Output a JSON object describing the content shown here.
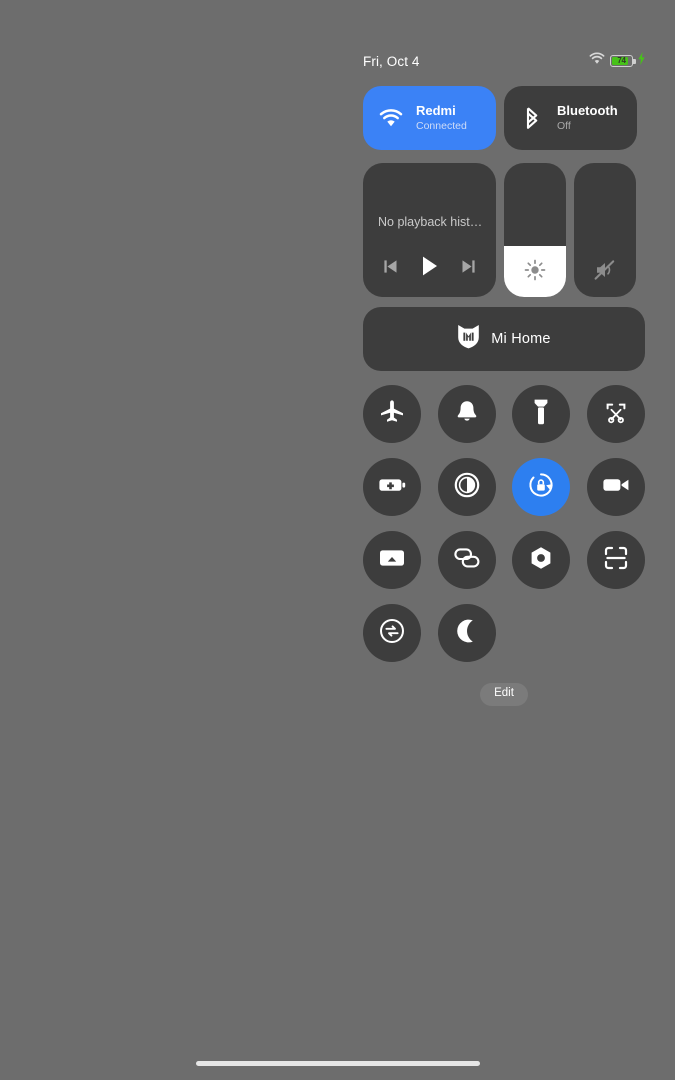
{
  "status_bar": {
    "date": "Fri, Oct 4",
    "wifi_icon": "wifi-icon",
    "battery_level": "74",
    "battery_charging_icon": "charging-bolt-icon"
  },
  "connectivity": [
    {
      "name": "wifi-tile",
      "icon": "wifi-icon",
      "title": "Redmi",
      "subtitle": "Connected",
      "active": true
    },
    {
      "name": "bluetooth-tile",
      "icon": "bluetooth-icon",
      "title": "Bluetooth",
      "subtitle": "Off",
      "active": false
    }
  ],
  "media": {
    "title": "No playback hist…",
    "previous_icon": "skip-previous-icon",
    "play_icon": "play-icon",
    "next_icon": "skip-next-icon"
  },
  "sliders": [
    {
      "name": "brightness-slider",
      "icon": "brightness-sun-icon",
      "value_percent": 38,
      "filled": true
    },
    {
      "name": "volume-slider",
      "icon": "volume-muted-icon",
      "value_percent": 0,
      "filled": false
    }
  ],
  "mi_home": {
    "label": "Mi Home",
    "icon": "mi-home-logo-icon"
  },
  "toggles": [
    {
      "name": "airplane-mode-toggle",
      "icon": "airplane-icon",
      "active": false
    },
    {
      "name": "ringer-toggle",
      "icon": "bell-icon",
      "active": false
    },
    {
      "name": "flashlight-toggle",
      "icon": "flashlight-icon",
      "active": false
    },
    {
      "name": "screenshot-toggle",
      "icon": "scissors-icon",
      "active": false
    },
    {
      "name": "battery-saver-toggle",
      "icon": "battery-plus-icon",
      "active": false
    },
    {
      "name": "reading-mode-toggle",
      "icon": "contrast-circle-icon",
      "active": false
    },
    {
      "name": "rotation-lock-toggle",
      "icon": "rotation-lock-icon",
      "active": true
    },
    {
      "name": "screen-recorder-toggle",
      "icon": "video-camera-icon",
      "active": false
    },
    {
      "name": "cast-toggle",
      "icon": "cast-screen-icon",
      "active": false
    },
    {
      "name": "link-toggle",
      "icon": "chain-link-icon",
      "active": false
    },
    {
      "name": "settings-toggle",
      "icon": "gear-nut-icon",
      "active": false
    },
    {
      "name": "scanner-toggle",
      "icon": "scan-frame-icon",
      "active": false
    },
    {
      "name": "sync-toggle",
      "icon": "sync-arrows-icon",
      "active": false
    },
    {
      "name": "dark-mode-toggle",
      "icon": "crescent-moon-icon",
      "active": false
    }
  ],
  "edit": {
    "label": "Edit"
  },
  "colors": {
    "background": "#6d6d6d",
    "tile": "#3d3d3d",
    "accent_active": "#3b82f6",
    "accent_toggle": "#2d7ff0",
    "battery_green": "#47c219",
    "slider_fill": "#ffffff"
  }
}
